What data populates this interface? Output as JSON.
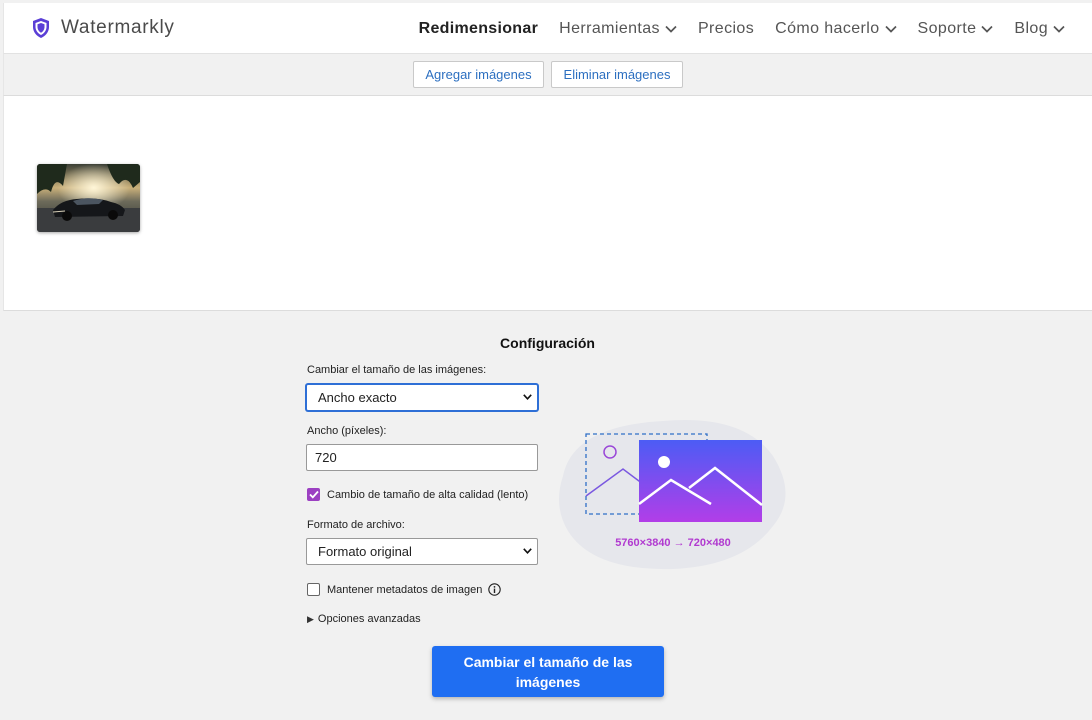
{
  "header": {
    "brand": "Watermarkly",
    "nav": [
      {
        "label": "Redimensionar",
        "active": true,
        "dropdown": false
      },
      {
        "label": "Herramientas",
        "active": false,
        "dropdown": true
      },
      {
        "label": "Precios",
        "active": false,
        "dropdown": false
      },
      {
        "label": "Cómo hacerlo",
        "active": false,
        "dropdown": true
      },
      {
        "label": "Soporte",
        "active": false,
        "dropdown": true
      },
      {
        "label": "Blog",
        "active": false,
        "dropdown": true
      }
    ]
  },
  "toolbar": {
    "add_label": "Agregar imágenes",
    "remove_label": "Eliminar imágenes"
  },
  "images": [
    {
      "icon": "car-photo-thumbnail"
    }
  ],
  "settings": {
    "title": "Configuración",
    "resize_label": "Cambiar el tamaño de las imágenes:",
    "resize_value": "Ancho exacto",
    "width_label": "Ancho (píxeles):",
    "width_value": "720",
    "hq_label": "Cambio de tamaño de alta calidad (lento)",
    "hq_checked": true,
    "format_label": "Formato de archivo:",
    "format_value": "Formato original",
    "metadata_label": "Mantener metadatos de imagen",
    "metadata_checked": false,
    "advanced_label": "Opciones avanzadas",
    "submit_label": "Cambiar el tamaño de las imágenes",
    "dims_text": "5760×3840 → 720×480"
  },
  "colors": {
    "primary": "#1f6ef2",
    "accent_purple": "#9c40c2",
    "link_blue": "#2c6fc0",
    "brand_shield": "#5b3fd6"
  }
}
